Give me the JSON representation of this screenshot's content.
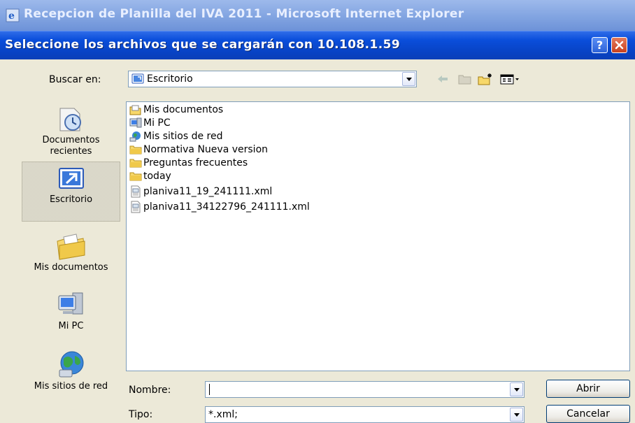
{
  "ie_window": {
    "title": "Recepcion de Planilla del IVA 2011 - Microsoft Internet Explorer"
  },
  "dialog": {
    "title": "Seleccione los archivos que se cargarán con 10.108.1.59",
    "help_label": "?",
    "look_in": {
      "label": "Buscar en:",
      "value": "Escritorio"
    },
    "places": [
      {
        "label": "Documentos recientes",
        "icon": "recent-documents-icon"
      },
      {
        "label": "Escritorio",
        "icon": "desktop-icon",
        "selected": true
      },
      {
        "label": "Mis documentos",
        "icon": "my-documents-icon"
      },
      {
        "label": "Mi PC",
        "icon": "my-computer-icon"
      },
      {
        "label": "Mis sitios de red",
        "icon": "network-places-icon"
      }
    ],
    "files": [
      {
        "name": "Mis documentos",
        "icon": "my-documents-folder-icon"
      },
      {
        "name": "Mi PC",
        "icon": "my-computer-icon"
      },
      {
        "name": "Mis sitios de red",
        "icon": "network-icon"
      },
      {
        "name": "Normativa Nueva version",
        "icon": "folder-icon"
      },
      {
        "name": "Preguntas frecuentes",
        "icon": "folder-icon"
      },
      {
        "name": "today",
        "icon": "folder-icon"
      },
      {
        "name": "planiva11_19_241111.xml",
        "icon": "xml-file-icon"
      },
      {
        "name": "planiva11_34122796_241111.xml",
        "icon": "xml-file-icon"
      }
    ],
    "filename": {
      "label": "Nombre:",
      "value": ""
    },
    "filetype": {
      "label": "Tipo:",
      "value": "*.xml;"
    },
    "open_button": "Abrir",
    "cancel_button": "Cancelar"
  }
}
